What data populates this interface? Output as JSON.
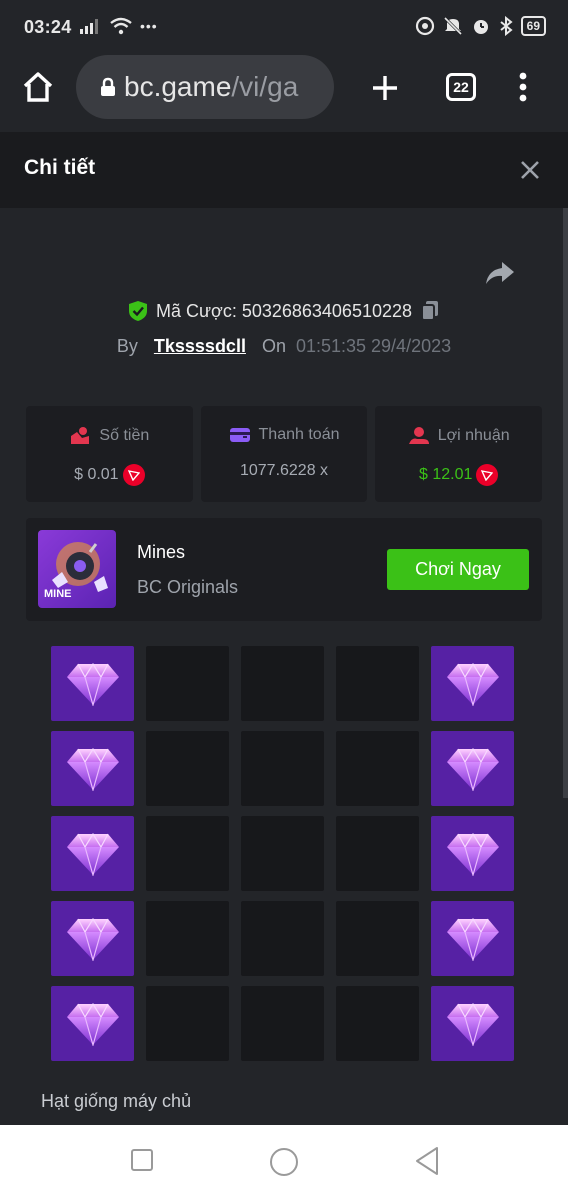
{
  "status_bar": {
    "time": "03:24",
    "battery": "69"
  },
  "browser": {
    "url_main": "bc.game",
    "url_path": "/vi/ga",
    "tab_count": "22"
  },
  "dialog": {
    "title": "Chi tiết"
  },
  "bet": {
    "id_label": "Mã Cược: 50326863406510228",
    "by_label": "By",
    "username": "Tkssssdcll",
    "on_label": "On",
    "datetime": "01:51:35 29/4/2023"
  },
  "stats": {
    "amount": {
      "label": "Số tiền",
      "value": "$ 0.01"
    },
    "payout": {
      "label": "Thanh toán",
      "value": "1077.6228 x"
    },
    "profit": {
      "label": "Lợi nhuận",
      "value": "$ 12.01"
    }
  },
  "game": {
    "thumb_label": "MINE",
    "name": "Mines",
    "provider": "BC Originals",
    "play_label": "Chơi Ngay"
  },
  "grid": {
    "tiles": [
      "gem",
      "empty",
      "empty",
      "empty",
      "gem",
      "gem",
      "empty",
      "empty",
      "empty",
      "gem",
      "gem",
      "empty",
      "empty",
      "empty",
      "gem",
      "gem",
      "empty",
      "empty",
      "empty",
      "gem",
      "gem",
      "empty",
      "empty",
      "empty",
      "gem"
    ]
  },
  "seed": {
    "label": "Hạt giống máy chủ"
  },
  "colors": {
    "accent_green": "#3bc117",
    "gem_tile": "#5621a4",
    "trx_red": "#eb0029"
  }
}
